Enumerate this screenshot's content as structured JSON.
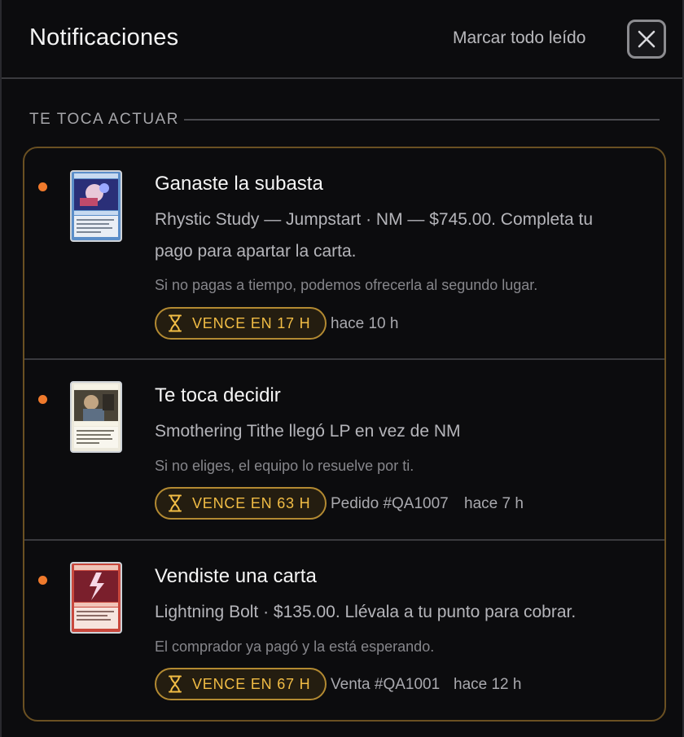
{
  "header": {
    "title": "Notificaciones",
    "mark_all_read": "Marcar todo leído"
  },
  "section": {
    "label": "TE TOCA ACTUAR"
  },
  "notifications": [
    {
      "card_name": "Rhystic Study",
      "card_color": "blue",
      "title": "Ganaste la subasta",
      "body": "Rhystic Study — Jumpstart · NM — $745.00. Completa tu pago para apartar la carta.",
      "hint": "Si no pagas a tiempo, podemos ofrecerla al segundo lugar.",
      "deadline": "VENCE EN 17 H",
      "reference": "",
      "time_ago": "hace 10 h"
    },
    {
      "card_name": "Smothering Tithe",
      "card_color": "white",
      "title": "Te toca decidir",
      "body": "Smothering Tithe llegó LP en vez de NM",
      "hint": "Si no eliges, el equipo lo resuelve por ti.",
      "deadline": "VENCE EN 63 H",
      "reference": "Pedido #QA1007",
      "time_ago": "hace 7 h"
    },
    {
      "card_name": "Lightning Bolt",
      "card_color": "red",
      "title": "Vendiste una carta",
      "body": "Lightning Bolt · $135.00. Llévala a tu punto para cobrar.",
      "hint": "El comprador ya pagó y la está esperando.",
      "deadline": "VENCE EN 67 H",
      "reference": "Venta #QA1001",
      "time_ago": "hace 12 h"
    }
  ],
  "icons": {
    "close": "close-icon",
    "deadline": "hourglass-icon",
    "unread": "unread-dot"
  },
  "colors": {
    "background": "#0c0c0e",
    "accent_orange": "#f07a2c",
    "badge_gold": "#f2bd45",
    "card_border": "#6a5022"
  }
}
